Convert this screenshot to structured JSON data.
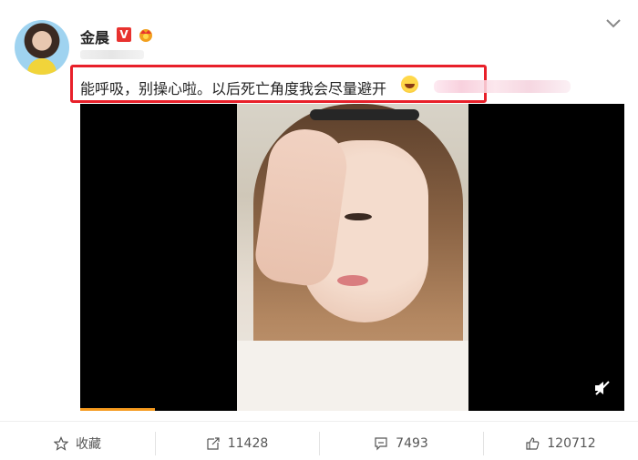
{
  "post": {
    "author_name": "金晨",
    "verified_badge_text": "V",
    "text": "能呼吸，别操心啦。以后死亡角度我会尽量避开"
  },
  "actions": {
    "favorite_label": "收藏",
    "repost_count": "11428",
    "comment_count": "7493",
    "like_count": "120712"
  },
  "icons": {
    "crown": "crown-badge-icon",
    "chevron": "chevron-down-icon",
    "emoji": "laughing-emoji-icon",
    "mute": "mute-icon",
    "star": "star-icon",
    "repost": "repost-icon",
    "comment": "comment-icon",
    "like": "thumbs-up-icon"
  },
  "colors": {
    "highlight_border": "#e8202a",
    "verified_red": "#e8322f",
    "progress_orange": "#f59a1e"
  }
}
